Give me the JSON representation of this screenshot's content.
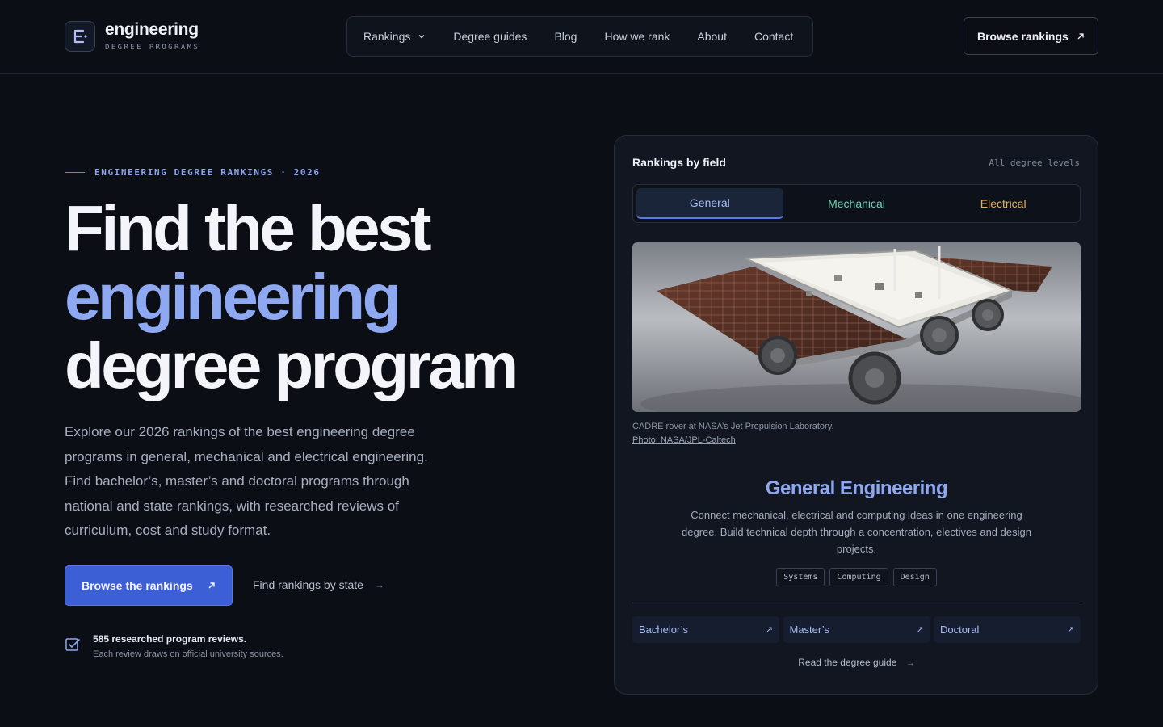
{
  "brand": {
    "title": "engineering",
    "subtitle": "DEGREE PROGRAMS"
  },
  "nav": {
    "items": [
      {
        "label": "Rankings",
        "has_dropdown": true
      },
      {
        "label": "Degree guides"
      },
      {
        "label": "Blog"
      },
      {
        "label": "How we rank"
      },
      {
        "label": "About"
      },
      {
        "label": "Contact"
      }
    ],
    "cta_label": "Browse rankings",
    "cta_icon": "arrow-up-right-icon"
  },
  "hero": {
    "eyebrow": "ENGINEERING DEGREE RANKINGS · 2026",
    "title_line1": "Find the best",
    "title_line2": "engineering",
    "title_line3": "degree program",
    "lead": "Explore our 2026 rankings of the best engineering degree programs in general, mechanical and electrical engineering. Find bachelor’s, master’s and doctoral programs through national and state rankings, with researched reviews of curriculum, cost and study format.",
    "primary_cta": "Browse the rankings",
    "secondary_cta": "Find rankings by state",
    "proof_title": "585 researched program reviews.",
    "proof_sub": "Each review draws on official university sources."
  },
  "card": {
    "title": "Rankings by field",
    "meta": "All degree levels",
    "tabs": [
      {
        "label": "General",
        "active": true
      },
      {
        "label": "Mechanical",
        "active": false
      },
      {
        "label": "Electrical",
        "active": false
      }
    ],
    "caption": "CADRE rover at NASA’s Jet Propulsion Laboratory.",
    "credit": "Photo: NASA/JPL-Caltech",
    "field_title": "General Engineering",
    "field_desc": "Connect mechanical, electrical and computing ideas in one engineering degree. Build technical depth through a concentration, electives and design projects.",
    "tags": [
      "Systems",
      "Computing",
      "Design"
    ],
    "levels": [
      {
        "label": "Bachelor’s"
      },
      {
        "label": "Master’s"
      },
      {
        "label": "Doctoral"
      }
    ],
    "guide_link": "Read the degree guide"
  },
  "colors": {
    "background": "#0b0e15",
    "accent": "#8fa8f2",
    "primary_button": "#3d5fd6",
    "mechanical": "#6fd1b6",
    "electrical": "#e3b35c"
  }
}
